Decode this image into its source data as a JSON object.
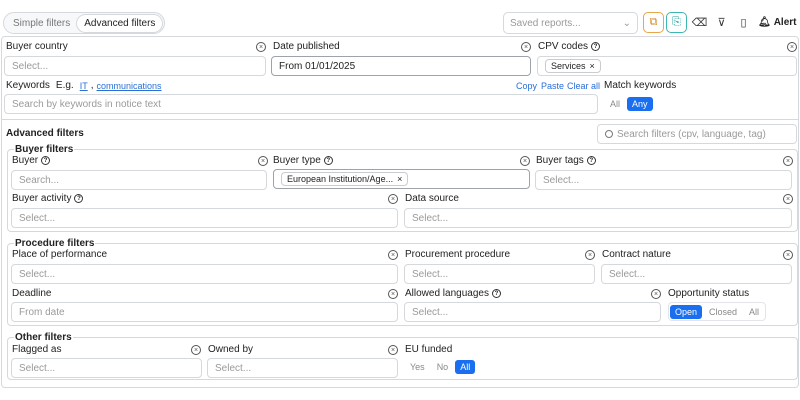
{
  "tabs": {
    "simple": "Simple filters",
    "advanced": "Advanced filters"
  },
  "toolbar": {
    "saved_reports_placeholder": "Saved reports...",
    "alert_label": "Alert"
  },
  "top": {
    "buyer_country": {
      "label": "Buyer country",
      "placeholder": "Select..."
    },
    "date_published": {
      "label": "Date published",
      "value": "From 01/01/2025"
    },
    "cpv_codes": {
      "label": "CPV codes",
      "chip": "Services"
    },
    "keywords": {
      "label": "Keywords",
      "hint": "E.g.",
      "ex1": "IT",
      "ex2": "communications",
      "placeholder": "Search by keywords in notice text",
      "copy": "Copy",
      "paste": "Paste",
      "clear": "Clear all"
    },
    "match": {
      "label": "Match keywords",
      "all": "All",
      "any": "Any"
    }
  },
  "advanced": {
    "title": "Advanced filters",
    "search_placeholder": "Search filters (cpv, language, tag)"
  },
  "buyer": {
    "title": "Buyer filters",
    "buyer": {
      "label": "Buyer",
      "placeholder": "Search..."
    },
    "buyer_type": {
      "label": "Buyer type",
      "chip": "European Institution/Age..."
    },
    "buyer_tags": {
      "label": "Buyer tags",
      "placeholder": "Select..."
    },
    "buyer_activity": {
      "label": "Buyer activity",
      "placeholder": "Select..."
    },
    "data_source": {
      "label": "Data source",
      "placeholder": "Select..."
    }
  },
  "procedure": {
    "title": "Procedure filters",
    "place": {
      "label": "Place of performance",
      "placeholder": "Select..."
    },
    "proc": {
      "label": "Procurement procedure",
      "placeholder": "Select..."
    },
    "nature": {
      "label": "Contract nature",
      "placeholder": "Select..."
    },
    "deadline": {
      "label": "Deadline",
      "placeholder": "From date"
    },
    "languages": {
      "label": "Allowed languages",
      "placeholder": "Select..."
    },
    "status": {
      "label": "Opportunity status",
      "open": "Open",
      "closed": "Closed",
      "all": "All"
    }
  },
  "other": {
    "title": "Other filters",
    "flagged": {
      "label": "Flagged as",
      "placeholder": "Select..."
    },
    "owned": {
      "label": "Owned by",
      "placeholder": "Select..."
    },
    "eu": {
      "label": "EU funded",
      "yes": "Yes",
      "no": "No",
      "all": "All"
    }
  }
}
